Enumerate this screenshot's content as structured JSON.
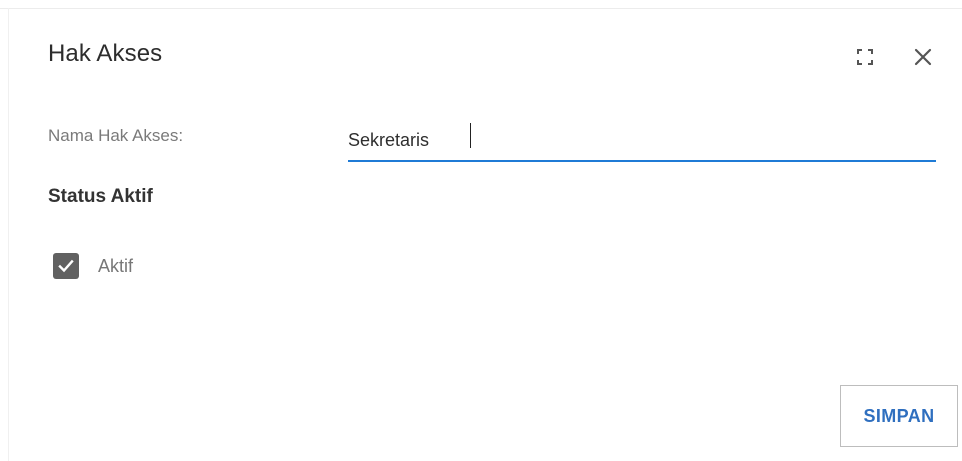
{
  "dialog": {
    "title": "Hak Akses",
    "expand_icon": "fullscreen-icon",
    "close_icon": "close-icon"
  },
  "form": {
    "name_label": "Nama Hak Akses:",
    "name_value": "Sekretaris",
    "status_title": "Status Aktif",
    "active_checkbox": {
      "label": "Aktif",
      "checked": true
    }
  },
  "actions": {
    "save_label": "SIMPAN"
  },
  "colors": {
    "accent": "#1f7bd6",
    "button_text": "#2f6fbf",
    "checkbox_fill": "#616161"
  }
}
